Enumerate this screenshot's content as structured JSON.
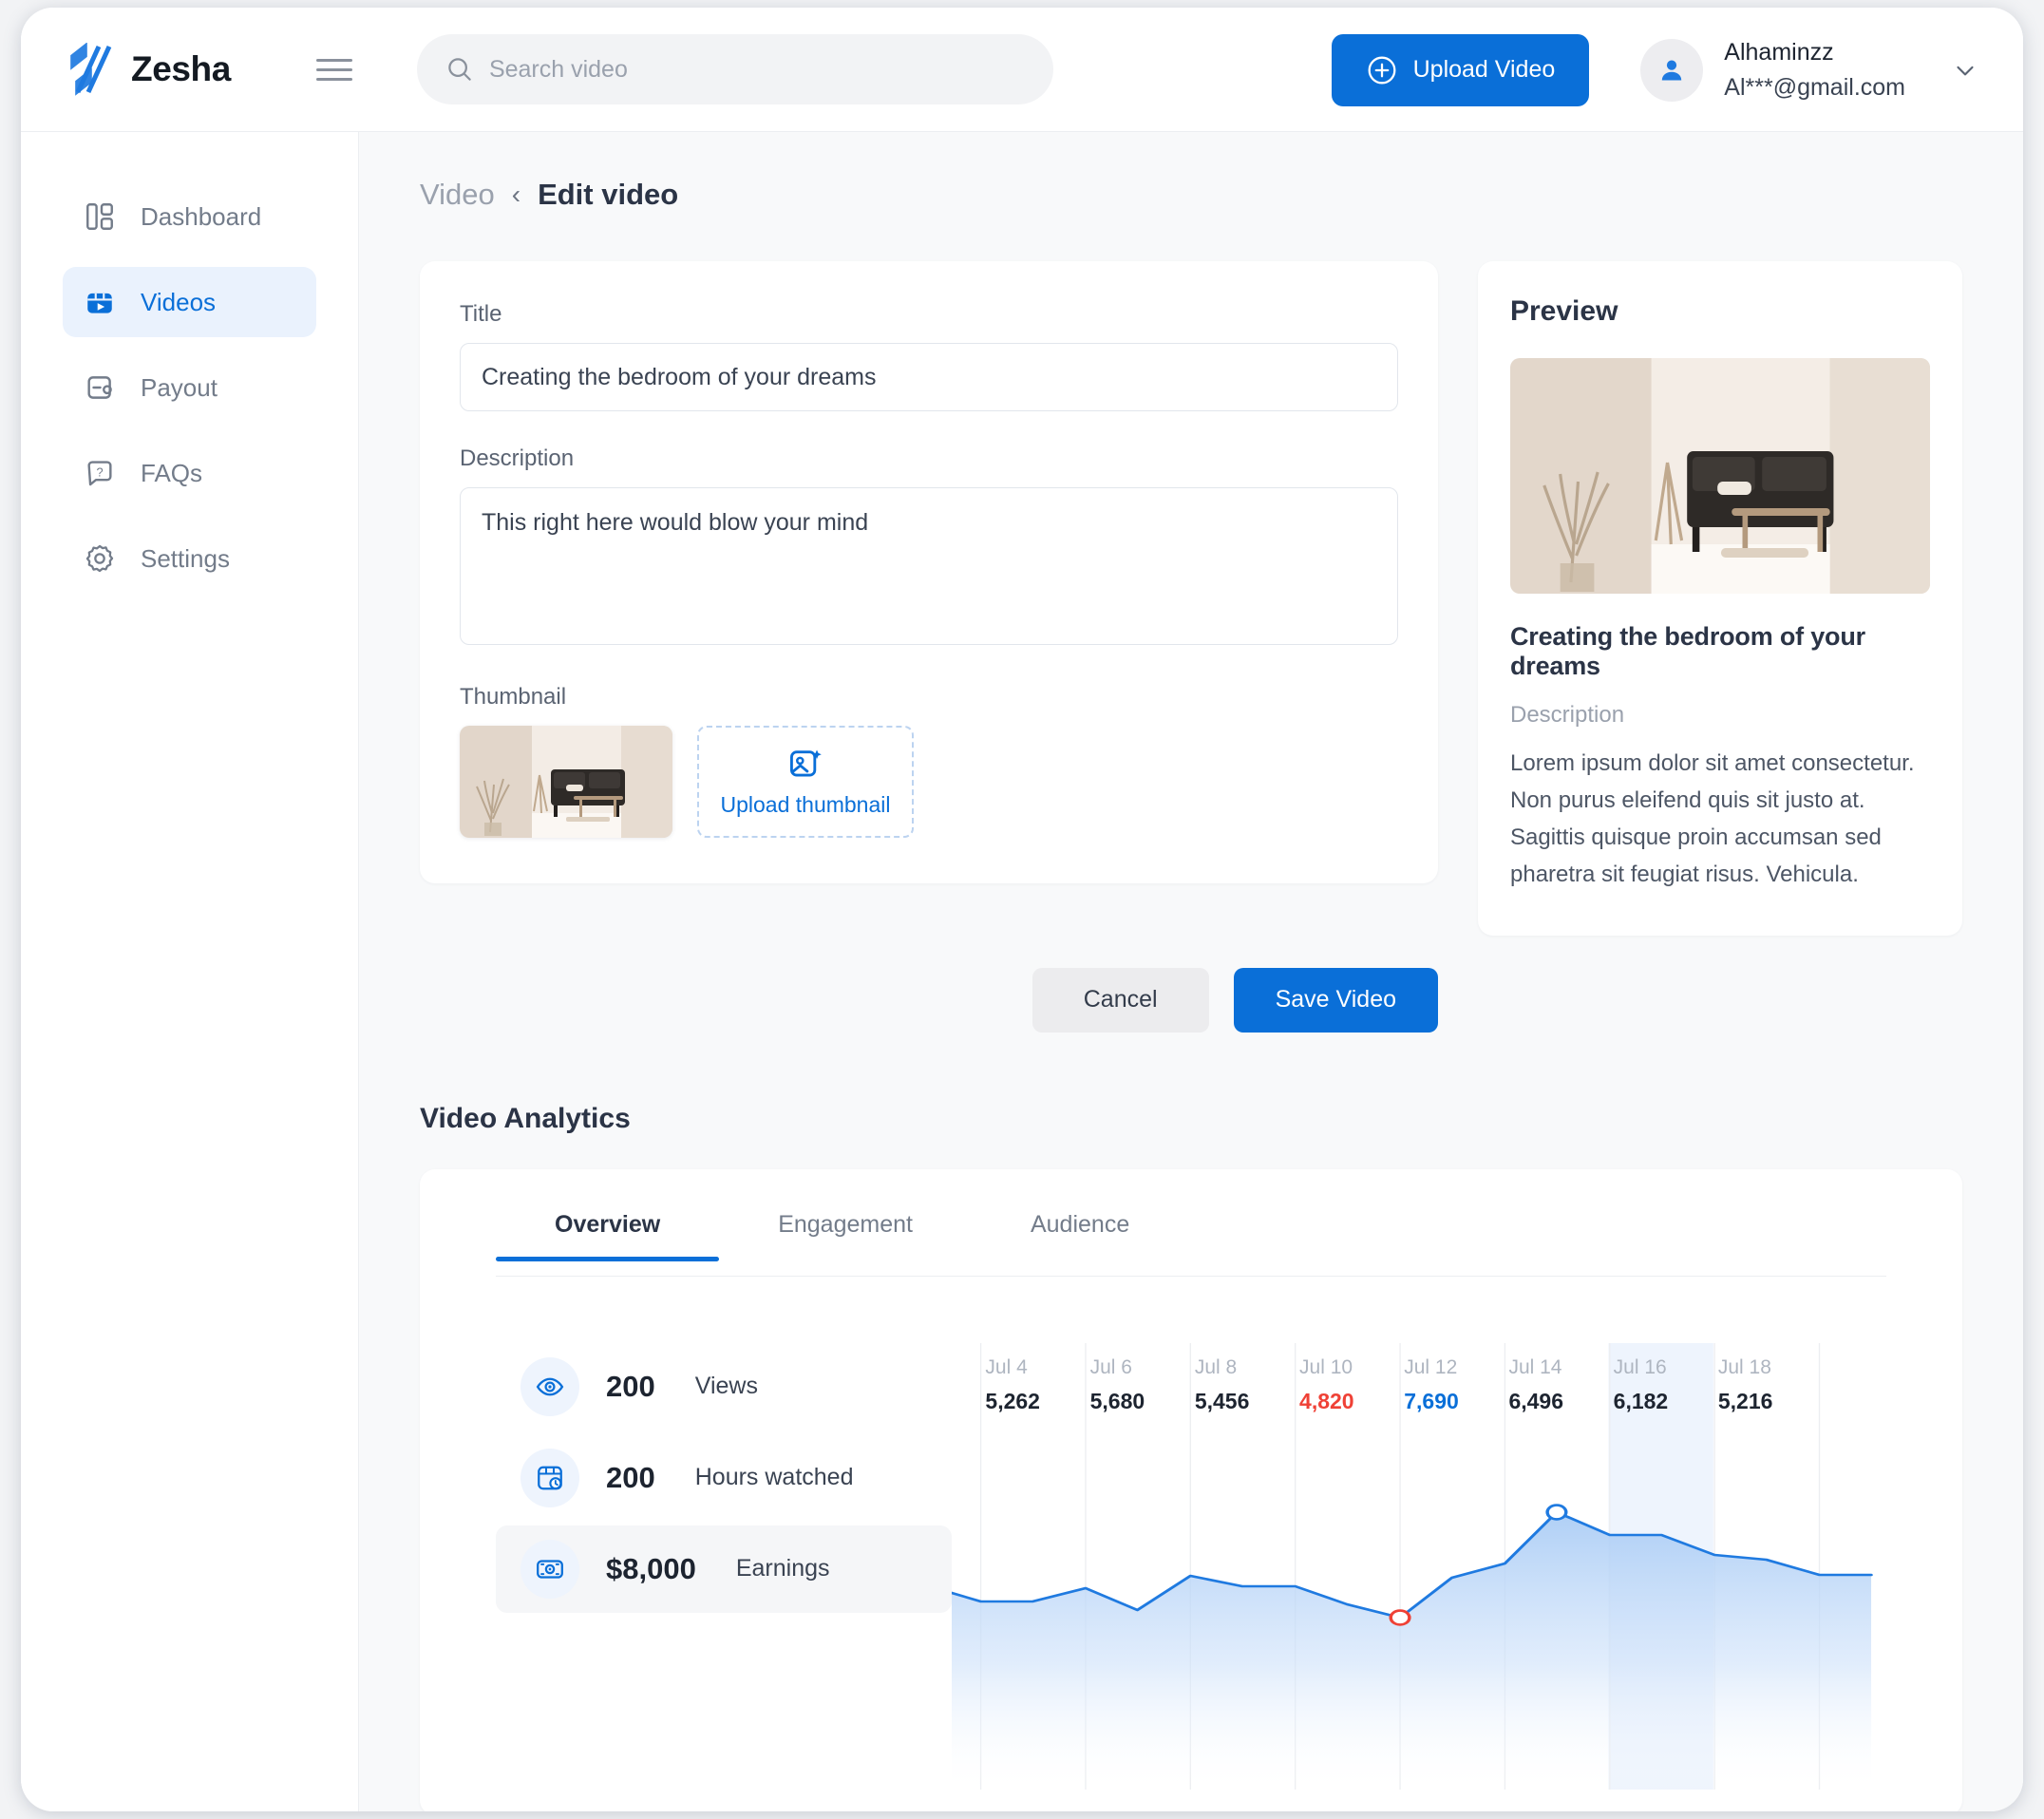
{
  "header": {
    "brand": "Zesha",
    "menu_icon": "hamburger-icon",
    "search": {
      "placeholder": "Search video",
      "value": ""
    },
    "upload_button": "Upload Video",
    "user": {
      "name": "Alhaminzz",
      "email": "Al***@gmail.com"
    }
  },
  "sidebar": {
    "items": [
      {
        "label": "Dashboard",
        "icon": "dashboard-icon",
        "active": false
      },
      {
        "label": "Videos",
        "icon": "video-icon",
        "active": true
      },
      {
        "label": "Payout",
        "icon": "wallet-icon",
        "active": false
      },
      {
        "label": "FAQs",
        "icon": "question-bubble-icon",
        "active": false
      },
      {
        "label": "Settings",
        "icon": "gear-icon",
        "active": false
      }
    ]
  },
  "breadcrumb": {
    "parent": "Video",
    "separator": "‹",
    "current": "Edit video"
  },
  "form": {
    "title_label": "Title",
    "title_value": "Creating the bedroom of your dreams",
    "title_placeholder": "Title",
    "description_label": "Description",
    "description_value": "This right here would blow your mind",
    "description_placeholder": "Description",
    "thumbnail_label": "Thumbnail",
    "upload_thumbnail_label": "Upload thumbnail",
    "cancel_label": "Cancel",
    "save_label": "Save Video"
  },
  "preview": {
    "heading": "Preview",
    "video_title": "Creating the bedroom of your dreams",
    "description_label": "Description",
    "description": "Lorem ipsum dolor sit amet consectetur. Non purus eleifend quis sit justo at. Sagittis quisque proin accumsan sed pharetra sit feugiat risus. Vehicula."
  },
  "analytics": {
    "heading": "Video Analytics",
    "tabs": [
      {
        "label": "Overview",
        "active": true
      },
      {
        "label": "Engagement",
        "active": false
      },
      {
        "label": "Audience",
        "active": false
      }
    ],
    "metrics": [
      {
        "value": "200",
        "label": "Views",
        "icon": "eye-icon",
        "selected": false
      },
      {
        "value": "200",
        "label": "Hours watched",
        "icon": "clock-window-icon",
        "selected": false
      },
      {
        "value": "$8,000",
        "label": "Earnings",
        "icon": "money-icon",
        "selected": true
      }
    ]
  },
  "colors": {
    "accent": "#0a6fd8",
    "accent_soft": "#eaf2fd",
    "text_dark": "#2b3446",
    "text_muted": "#9aa1ad",
    "low_marker": "#ef4136",
    "high_marker": "#0a6fd8",
    "page_bg": "#f8f9fa"
  },
  "chart_data": {
    "type": "area",
    "title": "",
    "xlabel": "",
    "ylabel": "Views",
    "grid": true,
    "legend": "none",
    "categories": [
      "Jul 4",
      "Jul 6",
      "Jul 8",
      "Jul 10",
      "Jul 12",
      "Jul 14",
      "Jul 16",
      "Jul 18"
    ],
    "values": [
      5262,
      5680,
      5456,
      4820,
      7690,
      6496,
      6182,
      5216
    ],
    "ylim": [
      4500,
      8000
    ],
    "label_colors": [
      "#1d2430",
      "#1d2430",
      "#1d2430",
      "#ef4136",
      "#0a6fd8",
      "#1d2430",
      "#1d2430",
      "#1d2430"
    ],
    "highlighted_column": "Jul 16",
    "markers": [
      {
        "category": "Jul 10",
        "value": 4820,
        "kind": "minimum",
        "color": "#ef4136"
      },
      {
        "category": "Jul 12",
        "value": 7690,
        "kind": "maximum",
        "color": "#0a6fd8"
      }
    ],
    "series": [
      {
        "name": "Views",
        "points": [
          5262,
          5100,
          5100,
          5320,
          5680,
          5000,
          5456,
          5290,
          5290,
          5180,
          4820,
          6000,
          6400,
          7690,
          6900,
          6900,
          6300,
          6182,
          6100,
          5400,
          5216,
          5216
        ]
      }
    ]
  }
}
